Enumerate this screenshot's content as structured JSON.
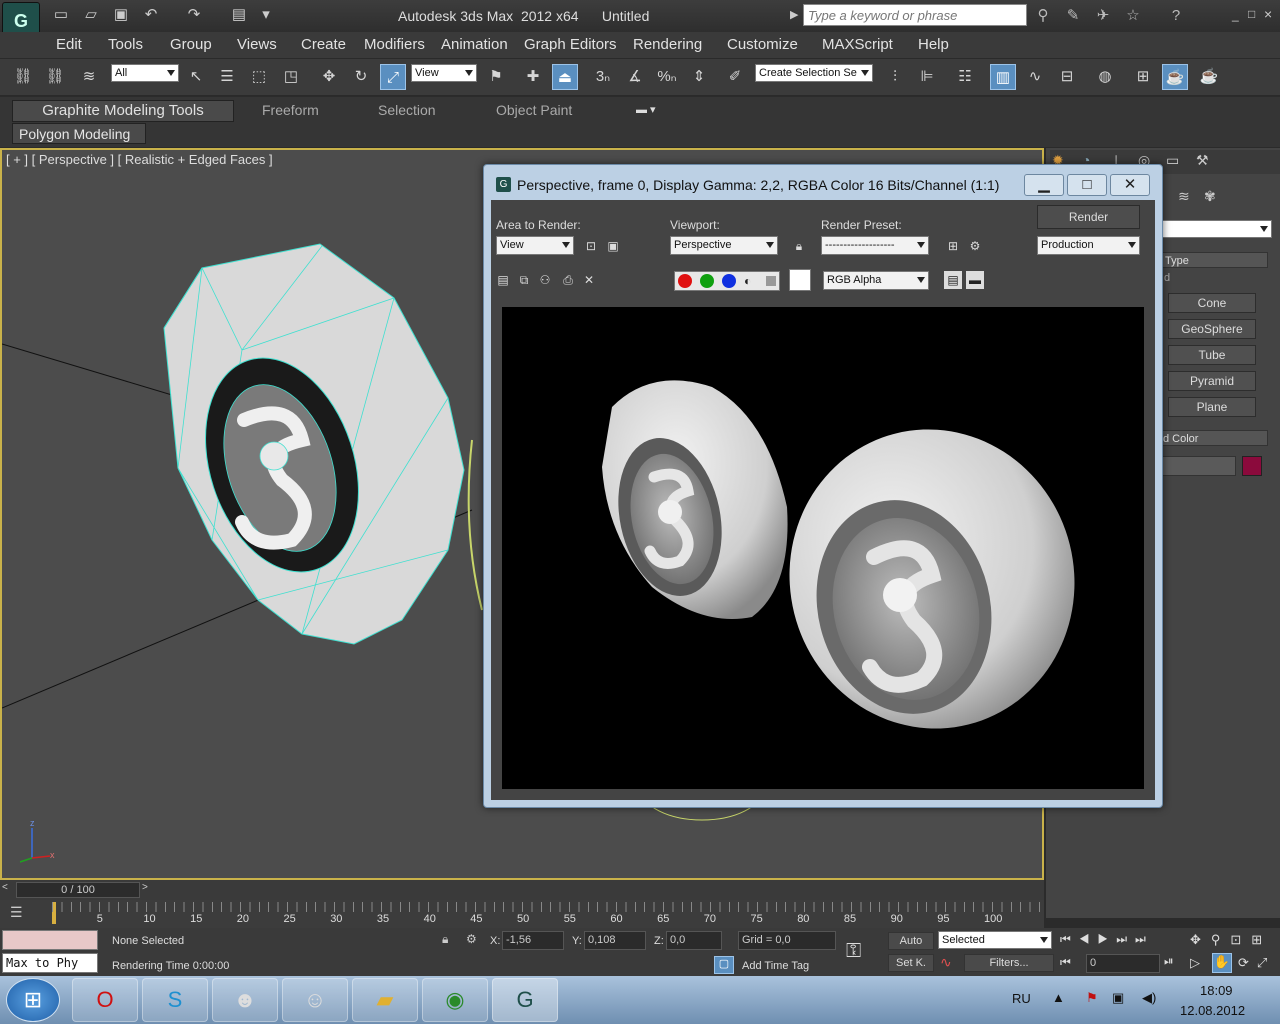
{
  "titlebar": {
    "app_logo": "G",
    "title": "Autodesk 3ds Max  2012 x64      Untitled",
    "search_placeholder": "Type a keyword or phrase",
    "win_controls": [
      "_",
      "□",
      "×"
    ]
  },
  "menubar": [
    "Edit",
    "Tools",
    "Group",
    "Views",
    "Create",
    "Modifiers",
    "Animation",
    "Graph Editors",
    "Rendering",
    "Customize",
    "MAXScript",
    "Help"
  ],
  "toolbar": {
    "selection_filter": "All",
    "reference_coord": "View",
    "named_selection_placeholder": "Create Selection Se",
    "snap_labels": [
      "3",
      "%"
    ]
  },
  "ribbon": {
    "tabs": [
      "Graphite Modeling Tools",
      "Freeform",
      "Selection",
      "Object Paint"
    ],
    "panel": "Polygon Modeling"
  },
  "viewport": {
    "label": "[ + ] [ Perspective ] [ Realistic + Edged Faces ]",
    "axes": [
      "z",
      "x"
    ]
  },
  "command_panel": {
    "rollout_type": "Type",
    "rollout_name_color": "d Color",
    "rollout_prefix": "d",
    "buttons": [
      "Cone",
      "GeoSphere",
      "Tube",
      "Pyramid",
      "Plane"
    ],
    "swatch_color": "#8b0a3c"
  },
  "render_window": {
    "title": "Perspective, frame 0, Display Gamma: 2,2, RGBA Color 16 Bits/Channel (1:1)",
    "area_label": "Area to Render:",
    "area_value": "View",
    "viewport_label": "Viewport:",
    "viewport_value": "Perspective",
    "preset_label": "Render Preset:",
    "preset_value": "-------------------",
    "render_button": "Render",
    "production_value": "Production",
    "channel_value": "RGB Alpha",
    "channel_colors": [
      "#e01010",
      "#10a010",
      "#1030e0"
    ]
  },
  "timeline": {
    "frame_readout": "0 / 100",
    "ticks": [
      "5",
      "10",
      "15",
      "20",
      "25",
      "30",
      "35",
      "40",
      "45",
      "50",
      "55",
      "60",
      "65",
      "70",
      "75",
      "80",
      "85",
      "90",
      "95",
      "100"
    ]
  },
  "status": {
    "maxscript_text": "Max to Phy",
    "selection": "None Selected",
    "render_time": "Rendering Time  0:00:00",
    "x_label": "X:",
    "x_value": "-1,56",
    "y_label": "Y:",
    "y_value": "0,108",
    "z_label": "Z:",
    "z_value": "0,0",
    "grid": "Grid = 0,0",
    "add_time_tag": "Add Time Tag",
    "auto": "Auto",
    "set_key": "Set K.",
    "key_filter": "Selected",
    "filters": "Filters...",
    "frame_field": "0"
  },
  "taskbar": {
    "lang": "RU",
    "time": "18:09",
    "date": "12.08.2012"
  }
}
